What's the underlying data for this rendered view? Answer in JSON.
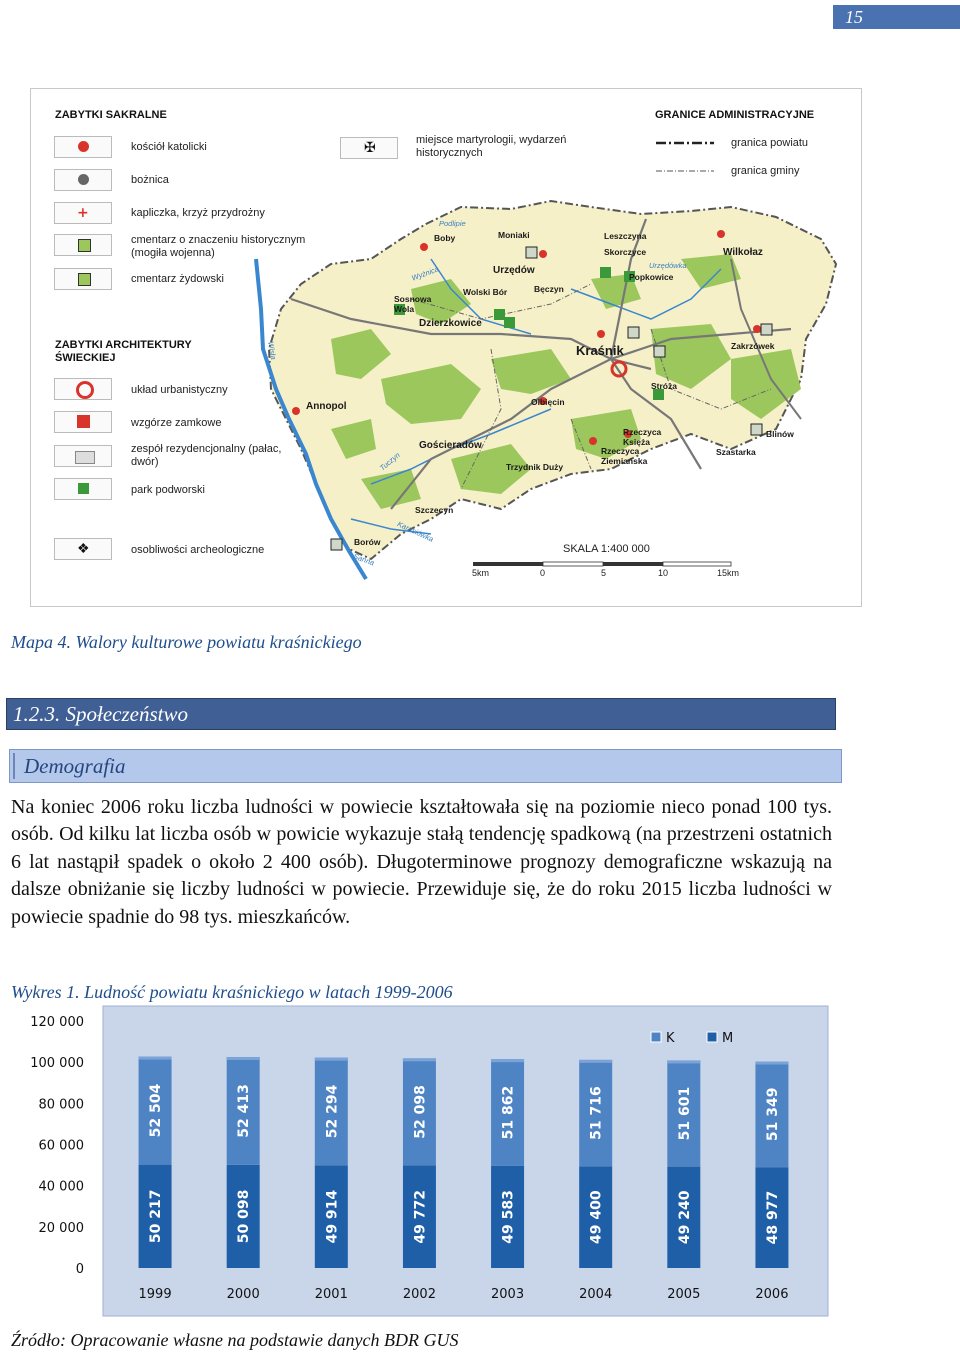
{
  "page_number": "15",
  "map": {
    "legend_sacral_title": "ZABYTKI SAKRALNE",
    "legend_sacral": [
      "kościół katolicki",
      "bożnica",
      "kapliczka, krzyż przydrożny",
      "cmentarz o znaczeniu historycznym (mogiła wojenna)",
      "cmentarz żydowski"
    ],
    "legend_martyr": "miejsce martyrologii, wydarzeń historycznych",
    "legend_admin_title": "GRANICE ADMINISTRACYJNE",
    "legend_admin": [
      "granica powiatu",
      "granica gminy"
    ],
    "legend_arch_title": "ZABYTKI ARCHITEKTURY ŚWIECKIEJ",
    "legend_arch": [
      "układ urbanistyczny",
      "wzgórze zamkowe",
      "zespół rezydencjonalny (pałac, dwór)",
      "park podworski",
      "osobliwości archeologiczne"
    ],
    "scale_label": "SKALA 1:400 000",
    "scale_ticks": [
      "5km",
      "0",
      "5",
      "10",
      "15km"
    ],
    "places": {
      "krasnik": "Kraśnik",
      "urzedow": "Urzędów",
      "wilkolaz": "Wilkołaz",
      "zakrzowek": "Zakrzówek",
      "dzierzkowice": "Dzierzkowice",
      "annopol": "Annopol",
      "goscieradow": "Gościeradów",
      "trzydnik": "Trzydnik Duży",
      "szastarka": "Szastarka",
      "olbiecin": "Olbięcin",
      "stroza": "Stróża",
      "moniaki": "Moniaki",
      "leszczyna": "Leszczyna",
      "skorczyce": "Skorczyce",
      "popkowice": "Popkowice",
      "boby": "Boby",
      "wolski_bor": "Wolski Bór",
      "beczyn": "Bęczyn",
      "sosnowa_wola": "Sosnowa Wola",
      "rzeczyca_ksieza": "Rzeczyca Księża",
      "rzeczyca_ziemianska": "Rzeczyca Ziemiańska",
      "blinow": "Blinów",
      "szczecyn": "Szczecyn",
      "borow": "Borów"
    },
    "rivers": {
      "wisla": "Wisła",
      "podlipie": "Podlipie",
      "wyznica": "Wyżnica",
      "urzedowka": "Urzędówka",
      "tuczyn": "Tuczyn",
      "karasiowka": "Karasiówka",
      "sanna": "Sanna"
    }
  },
  "map_caption": "Mapa 4. Walory kulturowe  powiatu kraśnickiego",
  "section_heading": "1.2.3.  Społeczeństwo",
  "subsection_heading": "Demografia",
  "paragraph": "Na koniec 2006 roku liczba ludności w powiecie kształtowała się na poziomie nieco ponad 100 tys. osób. Od kilku lat liczba osób w powicie wykazuje stałą tendencję spadkową (na przestrzeni ostatnich 6 lat nastąpił spadek o około 2 400 osób). Długoterminowe prognozy demograficzne wskazują na dalsze obniżanie się liczby ludności w powiecie. Przewiduje się, że do roku 2015 liczba ludności w powiecie spadnie do 98 tys. mieszkańców.",
  "chart_caption": "Wykres 1. Ludność powiatu kraśnickiego w latach 1999-2006",
  "chart_data": {
    "type": "bar",
    "stacked": true,
    "title": "",
    "categories": [
      "1999",
      "2000",
      "2001",
      "2002",
      "2003",
      "2004",
      "2005",
      "2006"
    ],
    "series": [
      {
        "name": "M",
        "values": [
          50217,
          50098,
          49914,
          49772,
          49583,
          49400,
          49240,
          48977
        ],
        "labels": [
          "50 217",
          "50 098",
          "49 914",
          "49 772",
          "49 583",
          "49 400",
          "49 240",
          "48 977"
        ]
      },
      {
        "name": "K",
        "values": [
          52504,
          52413,
          52294,
          52098,
          51862,
          51716,
          51601,
          51349
        ],
        "labels": [
          "52 504",
          "52 413",
          "52 294",
          "52 098",
          "51 862",
          "51 716",
          "51 601",
          "51 349"
        ]
      }
    ],
    "yticks": [
      "0",
      "20 000",
      "40 000",
      "60 000",
      "80 000",
      "100 000",
      "120 000"
    ],
    "ylim": [
      0,
      120000
    ],
    "legend": [
      "K",
      "M"
    ],
    "legend_position": "top-right",
    "colors": {
      "M": "#1f5fa8",
      "K": "#4f84c4",
      "background": "#c9d6ea"
    }
  },
  "source": "Źródło: Opracowanie własne na podstawie danych BDR GUS"
}
